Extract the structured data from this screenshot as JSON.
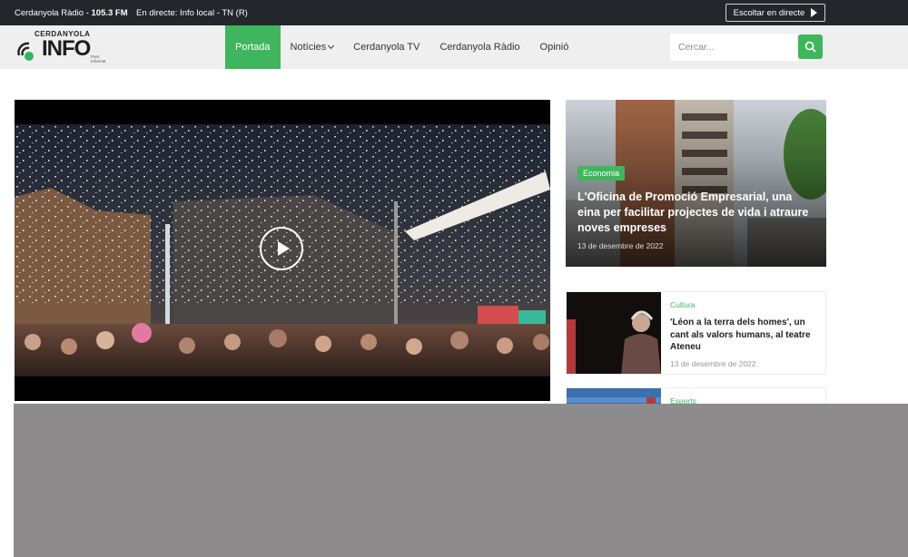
{
  "topbar": {
    "radio_prefix": "Cerdanyola Ràdio - ",
    "radio_freq": "105.3 FM",
    "live_text": "En directe: Info local - TN (R)",
    "listen_label": "Escoltar en directe"
  },
  "logo": {
    "top": "CERDANYOLA",
    "main": "INFO",
    "sub": "Punt Informat"
  },
  "nav": {
    "items": [
      {
        "label": "Portada",
        "active": true
      },
      {
        "label": "Notícies",
        "dropdown": true
      },
      {
        "label": "Cerdanyola TV"
      },
      {
        "label": "Cerdanyola Ràdio"
      },
      {
        "label": "Opinió"
      }
    ]
  },
  "search": {
    "placeholder": "Cercar..."
  },
  "feature": {
    "category": "Economia",
    "title": "L'Oficina de Promoció Empresarial, una eina per facilitar projectes de vida i atraure noves empreses",
    "date": "13 de desembre de 2022"
  },
  "cards": [
    {
      "category": "Cultura",
      "title": "'Léon a la terra dels homes', un cant als valors humans, al teatre Ateneu",
      "date": "13 de desembre de 2022"
    },
    {
      "category": "Esports"
    }
  ],
  "colors": {
    "accent": "#3fb55d",
    "topbar": "#23262b",
    "overlay": "#8d8b8c"
  }
}
